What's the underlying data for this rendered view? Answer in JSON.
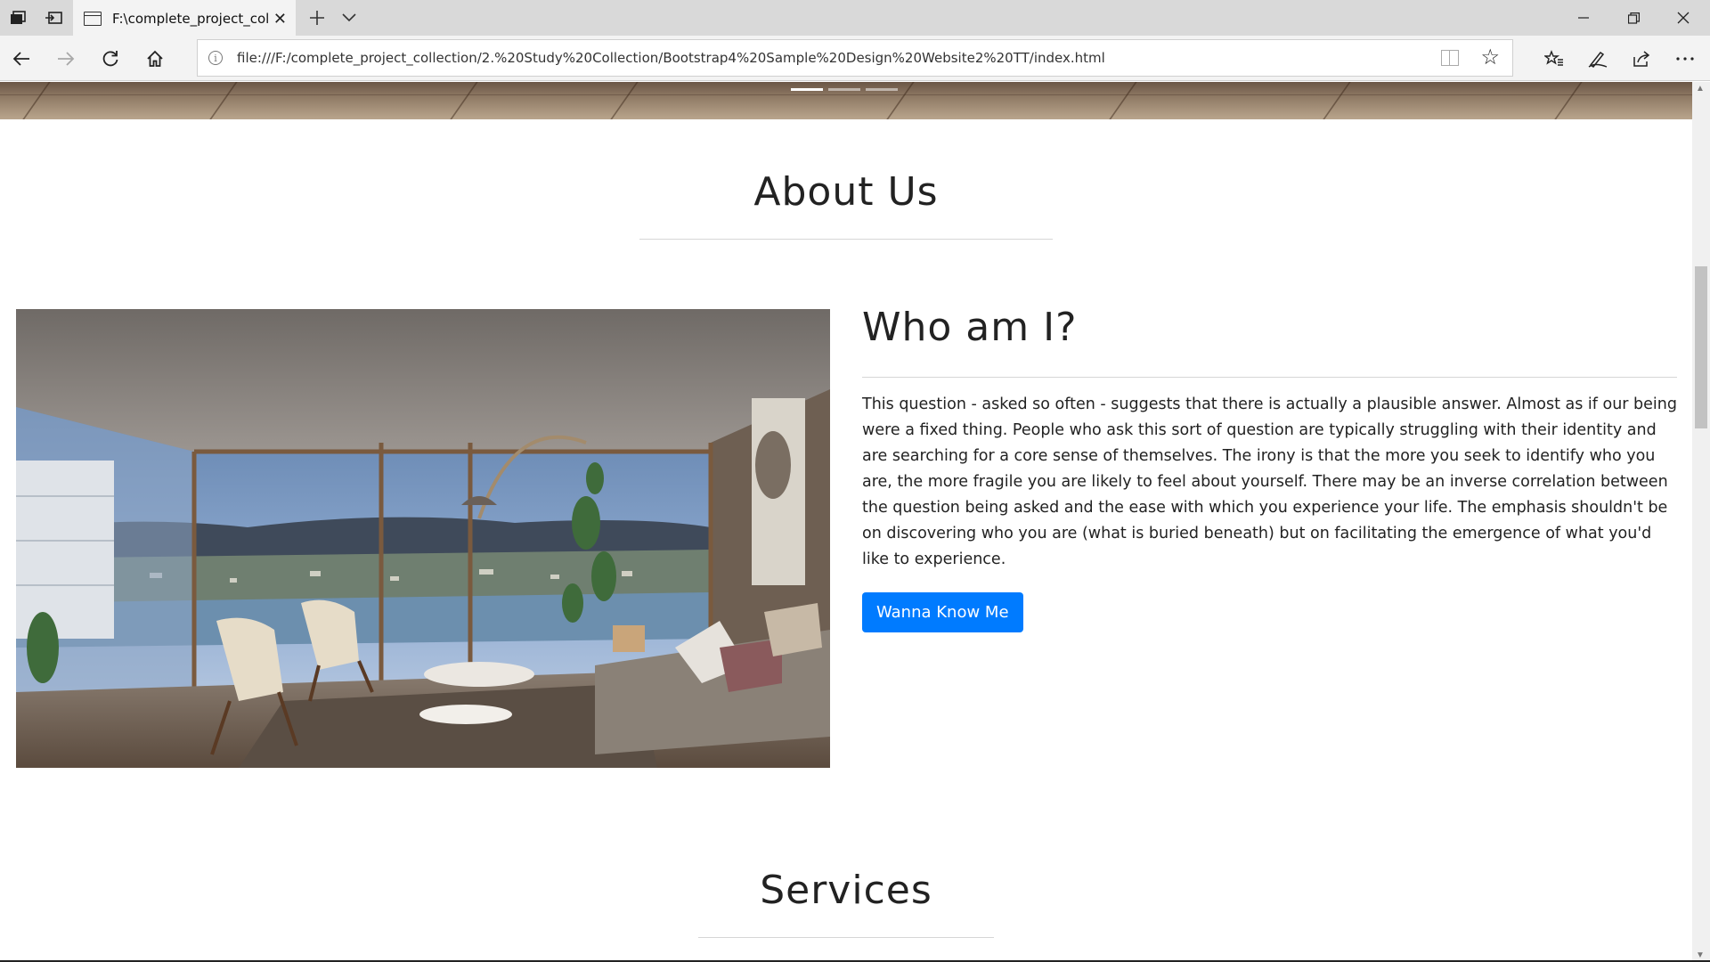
{
  "browser": {
    "tab_title": "F:\\complete_project_col",
    "url": "file:///F:/complete_project_collection/2.%20Study%20Collection/Bootstrap4%20Sample%20Design%20Website2%20TT/index.html"
  },
  "about": {
    "heading": "About Us",
    "subheading": "Who am I?",
    "body": "This question - asked so often - suggests that there is actually a plausible answer. Almost as if our being were a fixed thing. People who ask this sort of question are typically struggling with their identity and are searching for a core sense of themselves. The irony is that the more you seek to identify who you are, the more fragile you are likely to feel about yourself. There may be an inverse correlation between the question being asked and the ease with which you experience your life. The emphasis shouldn't be on discovering who you are (what is buried beneath) but on facilitating the emergence of what you'd like to experience.",
    "button_label": "Wanna Know Me"
  },
  "services": {
    "heading": "Services"
  },
  "carousel": {
    "indicator_count": 3,
    "active_index": 0
  },
  "colors": {
    "primary_button": "#007bff",
    "heading_text": "#222222"
  },
  "icons": {
    "tab_actions": "tab-actions-icon",
    "set_aside": "set-aside-tabs-icon",
    "page": "page-icon",
    "close": "close-icon",
    "new_tab": "plus-icon",
    "tab_menu": "chevron-down-icon",
    "back": "back-arrow-icon",
    "forward": "forward-arrow-icon",
    "refresh": "refresh-icon",
    "home": "home-icon",
    "info": "info-icon",
    "reading_view": "reading-view-icon",
    "favorite": "star-icon",
    "favorites_hub": "favorites-hub-icon",
    "notes": "pen-icon",
    "share": "share-icon",
    "more": "more-icon"
  }
}
